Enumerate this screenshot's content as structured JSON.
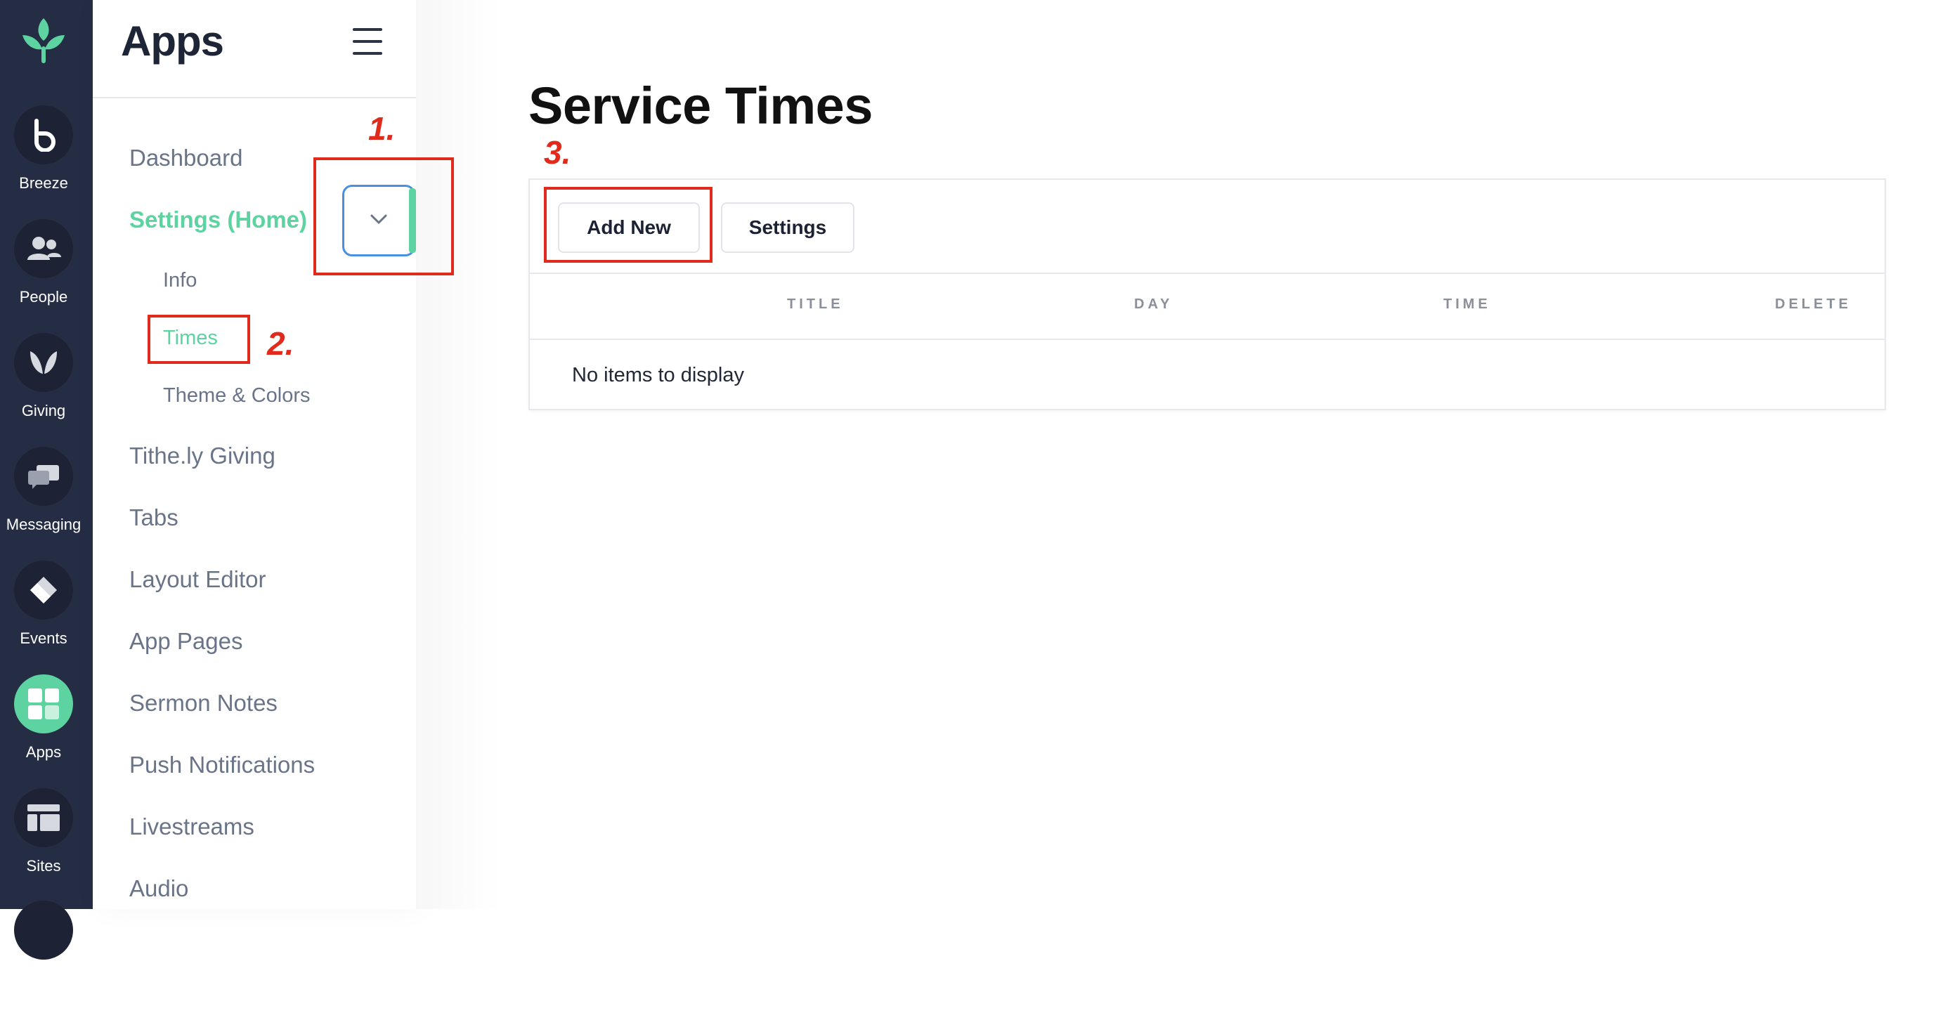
{
  "rail": {
    "items": [
      {
        "label": "Breeze",
        "icon": "breeze-icon"
      },
      {
        "label": "People",
        "icon": "people-icon"
      },
      {
        "label": "Giving",
        "icon": "giving-icon"
      },
      {
        "label": "Messaging",
        "icon": "messaging-icon"
      },
      {
        "label": "Events",
        "icon": "events-icon"
      },
      {
        "label": "Apps",
        "icon": "apps-icon"
      },
      {
        "label": "Sites",
        "icon": "sites-icon"
      }
    ]
  },
  "sidebar": {
    "title": "Apps",
    "items": [
      {
        "label": "Dashboard"
      },
      {
        "label": "Settings (Home)"
      },
      {
        "label": "Tithe.ly Giving"
      },
      {
        "label": "Tabs"
      },
      {
        "label": "Layout Editor"
      },
      {
        "label": "App Pages"
      },
      {
        "label": "Sermon Notes"
      },
      {
        "label": "Push Notifications"
      },
      {
        "label": "Livestreams"
      },
      {
        "label": "Audio"
      }
    ],
    "subitems": [
      {
        "label": "Info"
      },
      {
        "label": "Times"
      },
      {
        "label": "Theme & Colors"
      }
    ]
  },
  "main": {
    "title": "Service Times",
    "buttons": {
      "add_new": "Add New",
      "settings": "Settings"
    },
    "columns": [
      "TITLE",
      "DAY",
      "TIME",
      "DELETE"
    ],
    "empty_message": "No items to display"
  },
  "annotations": [
    "1.",
    "2.",
    "3."
  ],
  "colors": {
    "accent": "#5cd3a0",
    "rail": "#252d44",
    "annotation": "#e02a1c",
    "focus": "#4a90e2"
  }
}
